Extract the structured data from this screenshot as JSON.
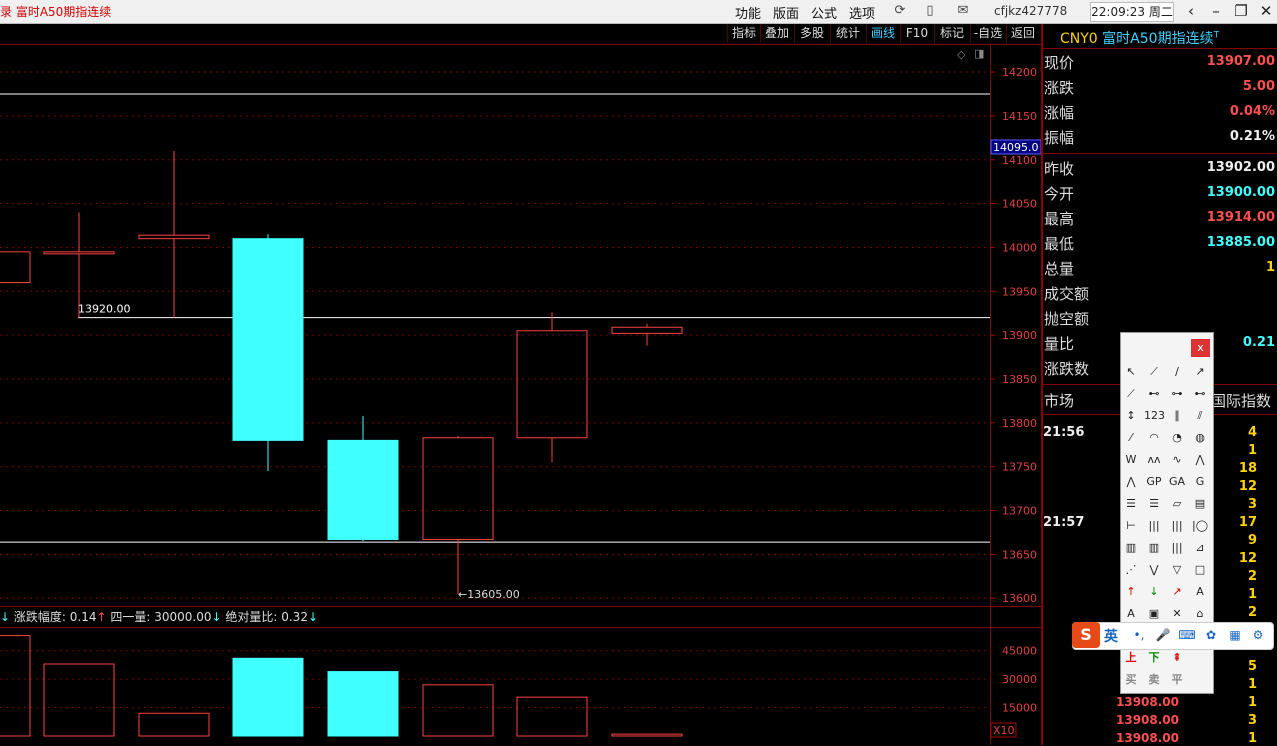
{
  "topbar": {
    "app_title": "录  富时A50期指连续",
    "menus": [
      "功能",
      "版面",
      "公式",
      "选项"
    ],
    "user": "cfjkz427778",
    "clock": "22:09:23 周二",
    "icons": [
      "refresh-icon",
      "phone-icon",
      "mail-icon",
      "back-icon",
      "minimize-icon",
      "restore-icon",
      "close-icon"
    ]
  },
  "chart_tabs": [
    "指标",
    "叠加",
    "多股",
    "统计",
    "画线",
    "F10",
    "标记",
    "-自选",
    "返回"
  ],
  "quote": {
    "code": "CNY0",
    "name": "富时A50期指连续",
    "superscript": "T",
    "rows1": [
      {
        "label": "现价",
        "value": "13907.00",
        "color": "red"
      },
      {
        "label": "涨跌",
        "value": "5.00",
        "color": "red"
      },
      {
        "label": "涨幅",
        "value": "0.04%",
        "color": "red"
      },
      {
        "label": "振幅",
        "value": "0.21%",
        "color": "white"
      }
    ],
    "rows2": [
      {
        "label": "昨收",
        "value": "13902.00",
        "color": "white"
      },
      {
        "label": "今开",
        "value": "13900.00",
        "color": "cyan"
      },
      {
        "label": "最高",
        "value": "13914.00",
        "color": "red"
      },
      {
        "label": "最低",
        "value": "13885.00",
        "color": "cyan"
      },
      {
        "label": "总量",
        "value": "1",
        "color": "yellow"
      },
      {
        "label": "成交额",
        "value": "",
        "color": "white"
      },
      {
        "label": "抛空额",
        "value": "",
        "color": "white"
      },
      {
        "label": "量比",
        "value": "0.21",
        "color": "cyan"
      },
      {
        "label": "涨跌数",
        "value": "",
        "color": "white"
      }
    ],
    "market_label": "市场",
    "market_right": "国际指数"
  },
  "ticks": {
    "times": [
      {
        "text": "21:56",
        "row": 0
      },
      {
        "text": "21:57",
        "row": 5
      }
    ],
    "volumes": [
      "4",
      "1",
      "18",
      "12",
      "3",
      "17",
      "9",
      "12",
      "2",
      "1",
      "2",
      "",
      "",
      "5",
      "1",
      "1",
      "3",
      "1"
    ],
    "prices": [
      {
        "text": "13908.00",
        "row": 15
      },
      {
        "text": "13908.00",
        "row": 16
      },
      {
        "text": "13908.00",
        "row": 17
      }
    ]
  },
  "palette": {
    "close": "x",
    "bottom_labels": [
      [
        "上",
        "下",
        "⇞"
      ],
      [
        "买",
        "卖",
        "平"
      ]
    ]
  },
  "ime": {
    "logo": "S",
    "lang": "英"
  },
  "indicators": {
    "a_label": "涨跌幅度: 0.14",
    "b_label": "四一量: 30000.00",
    "c_label": "绝对量比: 0.32"
  },
  "chart_data": {
    "type": "candlestick",
    "price_axis_ticks": [
      14200,
      14150,
      14100,
      14050,
      14000,
      13950,
      13900,
      13850,
      13800,
      13750,
      13700,
      13650,
      13600
    ],
    "price_ylim": [
      13590,
      14232
    ],
    "current_price_tag": "14095.0",
    "annotation_high_line": "13920.00",
    "annotation_low": "13605.00",
    "horizontal_lines": [
      14175,
      13920,
      13664
    ],
    "candles": [
      {
        "open": 13960,
        "close": 13995,
        "high": 13995,
        "low": 13960,
        "up": true
      },
      {
        "open": 13993,
        "close": 13995,
        "high": 14040,
        "low": 13920,
        "up": true
      },
      {
        "open": 14010,
        "close": 14014,
        "high": 14110,
        "low": 13920,
        "up": true
      },
      {
        "open": 14010,
        "close": 13780,
        "high": 14015,
        "low": 13745,
        "up": false
      },
      {
        "open": 13780,
        "close": 13667,
        "high": 13808,
        "low": 13665,
        "up": false
      },
      {
        "open": 13667,
        "close": 13783,
        "high": 13785,
        "low": 13605,
        "up": true
      },
      {
        "open": 13783,
        "close": 13905,
        "high": 13926,
        "low": 13755,
        "up": true
      },
      {
        "open": 13902,
        "close": 13909,
        "high": 13913,
        "low": 13888,
        "up": true
      }
    ],
    "volume_axis_ticks": [
      45000,
      30000,
      15000
    ],
    "volume_unit": "X10",
    "volume_ylim": [
      0,
      57000
    ],
    "volumes": [
      {
        "value": 53000,
        "up": true
      },
      {
        "value": 38000,
        "up": true
      },
      {
        "value": 12000,
        "up": true
      },
      {
        "value": 41000,
        "up": false
      },
      {
        "value": 34000,
        "up": false
      },
      {
        "value": 27000,
        "up": true
      },
      {
        "value": 20500,
        "up": true
      },
      {
        "value": 1000,
        "up": true
      }
    ]
  }
}
